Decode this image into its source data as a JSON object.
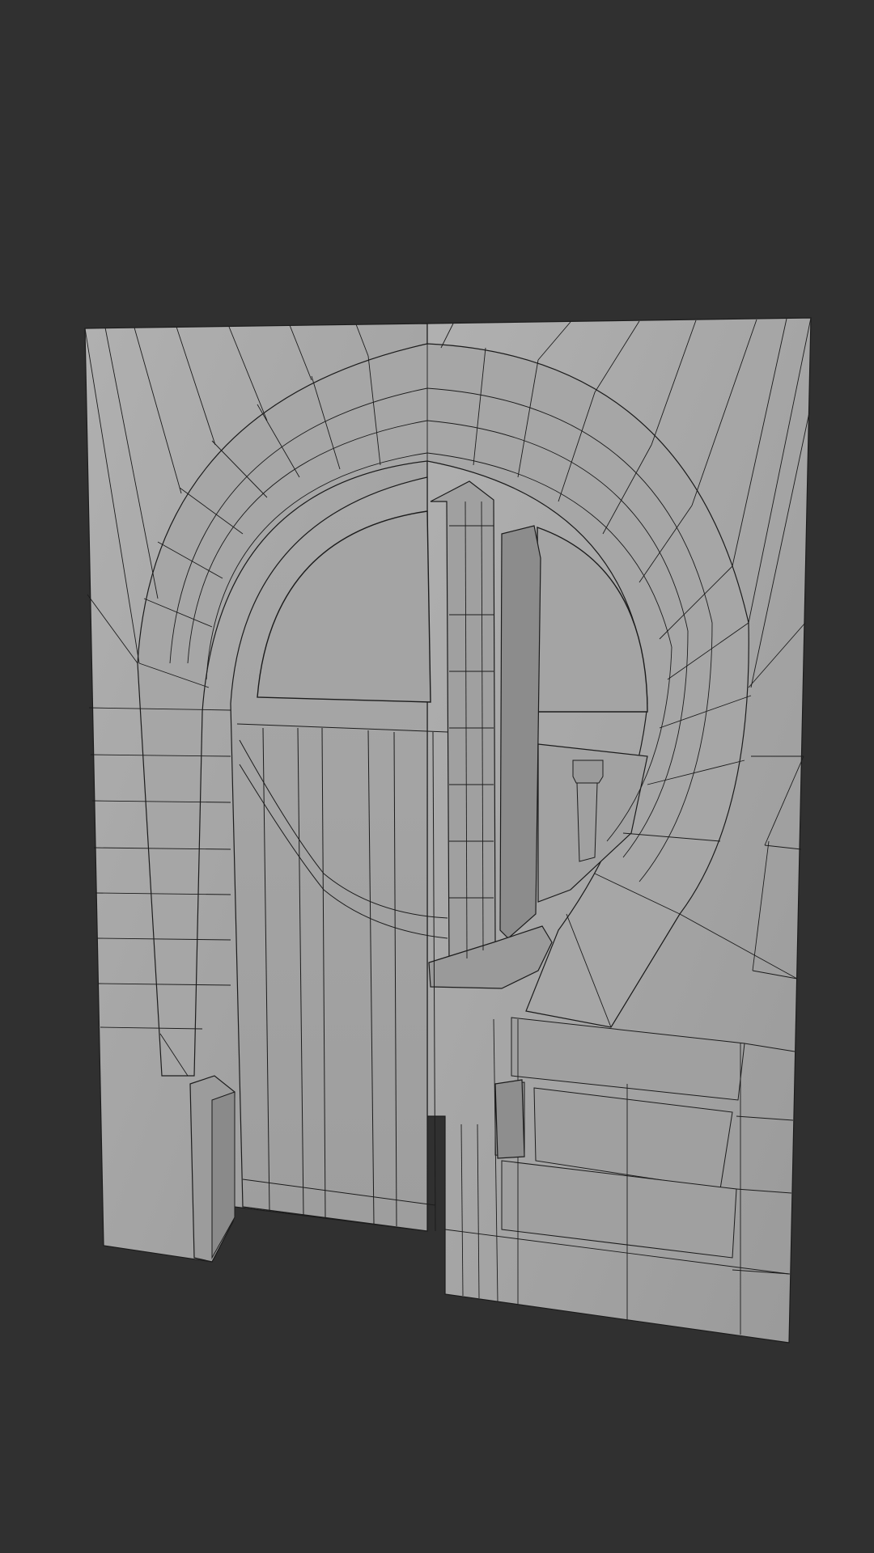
{
  "viewport": {
    "background_color": "#303030"
  },
  "model": {
    "subject": "arched-doorway-wireframe",
    "surface_color": "#a3a3a3",
    "surface_shade_color": "#8c8c8c",
    "surface_light_color": "#b8b8b8",
    "edge_color": "#1c1c1c"
  }
}
